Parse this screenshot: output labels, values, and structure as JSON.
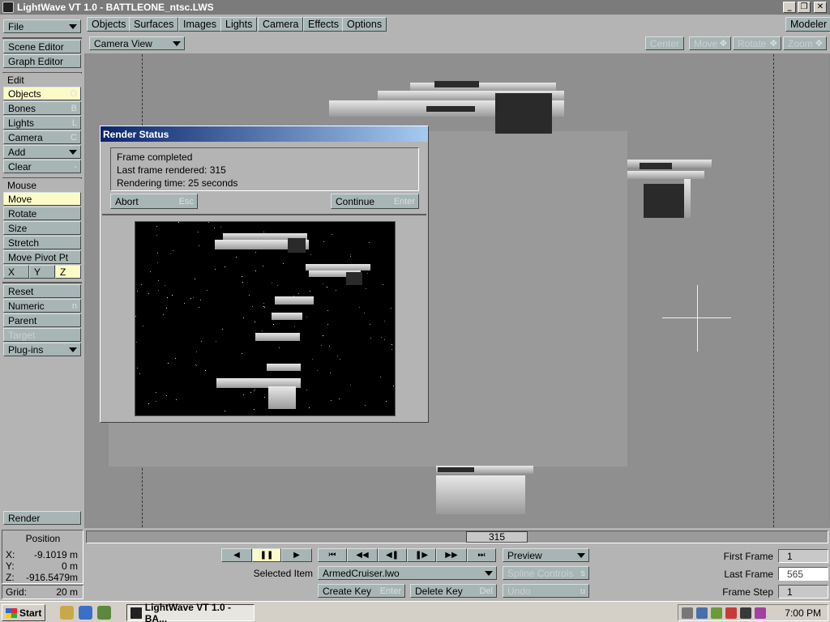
{
  "window": {
    "title": "LightWave VT 1.0 - BATTLEONE_ntsc.LWS"
  },
  "left": {
    "file": "File",
    "scene_editor": "Scene Editor",
    "graph_editor": "Graph Editor",
    "edit": "Edit",
    "objects": "Objects",
    "objects_key": "O",
    "bones": "Bones",
    "bones_key": "B",
    "lights": "Lights",
    "lights_key": "L",
    "camera": "Camera",
    "camera_key": "C",
    "add": "Add",
    "clear": "Clear",
    "clear_key": "-",
    "mouse": "Mouse",
    "move": "Move",
    "rotate": "Rotate",
    "size": "Size",
    "stretch": "Stretch",
    "move_pivot": "Move Pivot Pt",
    "x": "X",
    "y": "Y",
    "z": "Z",
    "reset": "Reset",
    "numeric": "Numeric",
    "numeric_key": "n",
    "parent": "Parent",
    "target": "Target",
    "plugins": "Plug-ins",
    "render": "Render"
  },
  "menu": {
    "tabs": [
      "Objects",
      "Surfaces",
      "Images",
      "Lights",
      "Camera",
      "Effects",
      "Options"
    ],
    "modeler": "Modeler",
    "view": "Camera View",
    "center": "Center",
    "move": "Move",
    "rotate": "Rotate",
    "zoom": "Zoom"
  },
  "dialog": {
    "title": "Render Status",
    "line1": "Frame completed",
    "line2": "Last frame rendered: 315",
    "line3": "Rendering time: 25 seconds",
    "abort": "Abort",
    "abort_key": "Esc",
    "continue": "Continue",
    "continue_key": "Enter"
  },
  "position": {
    "label": "Position",
    "x_label": "X:",
    "x": "-9.1019 m",
    "y_label": "Y:",
    "y": "0 m",
    "z_label": "Z:",
    "z": "-916.5479m",
    "grid_label": "Grid:",
    "grid": "20 m"
  },
  "timeline": {
    "frame": "315",
    "selected_label": "Selected Item",
    "selected": "ArmedCruiser.lwo",
    "create_key": "Create Key",
    "create_key_key": "Enter",
    "delete_key": "Delete Key",
    "delete_key_key": "Del",
    "preview": "Preview",
    "spline": "Spline Controls",
    "spline_key": "s",
    "undo": "Undo",
    "undo_key": "u",
    "first_label": "First Frame",
    "first": "1",
    "last_label": "Last Frame",
    "last": "565",
    "step_label": "Frame Step",
    "step": "1"
  },
  "taskbar": {
    "start": "Start",
    "task": "LightWave VT 1.0 - BA...",
    "clock": "7:00 PM"
  },
  "colors": {
    "active": "#fbfbc8",
    "button": "#a8b5b5",
    "title_gradient_start": "#0a246a"
  }
}
